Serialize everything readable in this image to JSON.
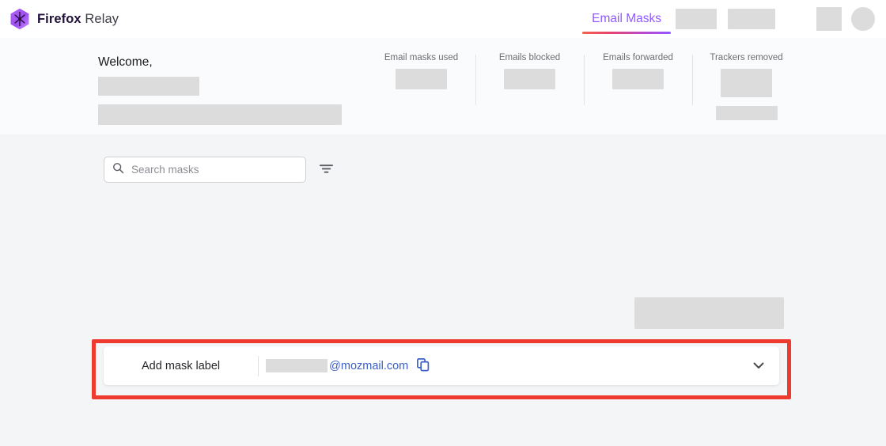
{
  "header": {
    "brand_bold": "Firefox",
    "brand_light": "Relay",
    "logo_icon": "firefox-relay-hexagon-logo",
    "nav": {
      "active_item": "Email Masks",
      "placeholder_items": [
        "",
        "",
        ""
      ],
      "avatar_icon": "user-avatar"
    }
  },
  "hero": {
    "welcome_title": "Welcome,",
    "stats": [
      {
        "label": "Email masks used"
      },
      {
        "label": "Emails blocked"
      },
      {
        "label": "Emails forwarded"
      },
      {
        "label": "Trackers removed"
      }
    ]
  },
  "toolbar": {
    "search_placeholder": "Search masks",
    "search_value": "",
    "search_icon": "search-icon",
    "filter_icon": "filter-icon",
    "generate_button_label": ""
  },
  "mask_card": {
    "label": "Add mask label",
    "domain": "@mozmail.com",
    "copy_icon": "copy-icon",
    "expand_icon": "chevron-down-icon"
  },
  "annotation": {
    "highlight_color": "#ef3b2f"
  },
  "colors": {
    "accent_purple": "#9059ff",
    "link_blue": "#3b5fc4",
    "redact_gray": "#dcdcdc",
    "page_bg": "#f4f5f7",
    "hero_bg": "#fafbfc"
  }
}
